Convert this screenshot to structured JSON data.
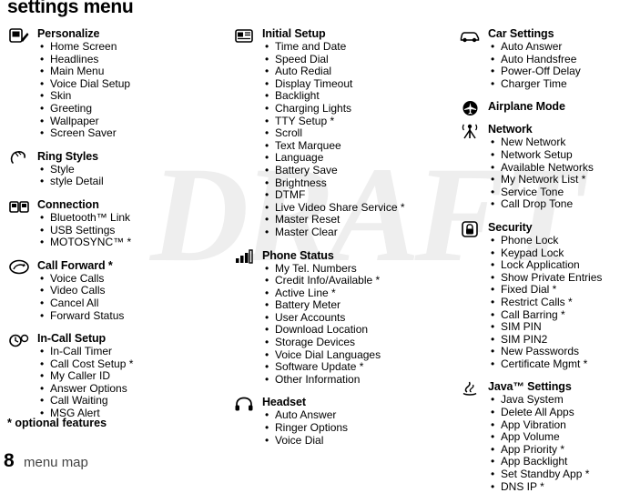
{
  "page": {
    "title": "settings menu",
    "watermark": "DRAFT",
    "footnote": "* optional features",
    "page_number": "8",
    "page_label": "menu map"
  },
  "columns": [
    {
      "groups": [
        {
          "icon": "personalize-icon",
          "heading": "Personalize",
          "items": [
            "Home Screen",
            "Headlines",
            "Main Menu",
            "Voice Dial Setup",
            "Skin",
            "Greeting",
            "Wallpaper",
            "Screen Saver"
          ]
        },
        {
          "icon": "ring-styles-icon",
          "heading": "Ring Styles",
          "items": [
            "Style",
            " style Detail"
          ]
        },
        {
          "icon": "connection-icon",
          "heading": "Connection",
          "items": [
            "Bluetooth™ Link",
            "USB Settings",
            "MOTOSYNC™ *"
          ]
        },
        {
          "icon": "call-forward-icon",
          "heading": "Call Forward *",
          "items": [
            "Voice Calls",
            "Video Calls",
            "Cancel All",
            "Forward Status"
          ]
        },
        {
          "icon": "in-call-setup-icon",
          "heading": "In-Call Setup",
          "items": [
            "In-Call Timer",
            "Call Cost Setup *",
            "My Caller ID",
            "Answer Options",
            "Call Waiting",
            "MSG Alert"
          ]
        }
      ]
    },
    {
      "groups": [
        {
          "icon": "initial-setup-icon",
          "heading": "Initial Setup",
          "items": [
            "Time and Date",
            "Speed Dial",
            "Auto Redial",
            "Display Timeout",
            "Backlight",
            "Charging Lights",
            "TTY Setup *",
            "Scroll",
            "Text Marquee",
            "Language",
            "Battery Save",
            "Brightness",
            "DTMF",
            "Live Video Share Service *",
            "Master Reset",
            "Master Clear"
          ]
        },
        {
          "icon": "phone-status-icon",
          "heading": "Phone Status",
          "items": [
            "My Tel. Numbers",
            "Credit Info/Available *",
            "Active Line *",
            "Battery Meter",
            "User Accounts",
            "Download Location",
            "Storage Devices",
            "Voice Dial Languages",
            "Software Update *",
            "Other Information"
          ]
        },
        {
          "icon": "headset-icon",
          "heading": "Headset",
          "items": [
            "Auto Answer",
            "Ringer Options",
            "Voice Dial"
          ]
        }
      ]
    },
    {
      "groups": [
        {
          "icon": "car-settings-icon",
          "heading": "Car Settings",
          "items": [
            "Auto Answer",
            "Auto Handsfree",
            "Power-Off Delay",
            "Charger Time"
          ]
        },
        {
          "icon": "airplane-mode-icon",
          "heading": "Airplane Mode",
          "items": []
        },
        {
          "icon": "network-icon",
          "heading": "Network",
          "items": [
            "New Network",
            "Network Setup",
            "Available Networks",
            "My Network List *",
            "Service Tone",
            "Call Drop Tone"
          ]
        },
        {
          "icon": "security-icon",
          "heading": "Security",
          "items": [
            "Phone Lock",
            "Keypad Lock",
            "Lock Application",
            "Show Private Entries",
            "Fixed Dial *",
            "Restrict Calls *",
            "Call Barring *",
            "SIM PIN",
            "SIM PIN2",
            "New Passwords",
            "Certificate Mgmt *"
          ]
        },
        {
          "icon": "java-settings-icon",
          "heading": "Java™ Settings",
          "items": [
            "Java System",
            "Delete All Apps",
            "App Vibration",
            "App Volume",
            "App Priority *",
            "App Backlight",
            "Set Standby App *",
            "DNS IP *"
          ]
        }
      ]
    }
  ]
}
